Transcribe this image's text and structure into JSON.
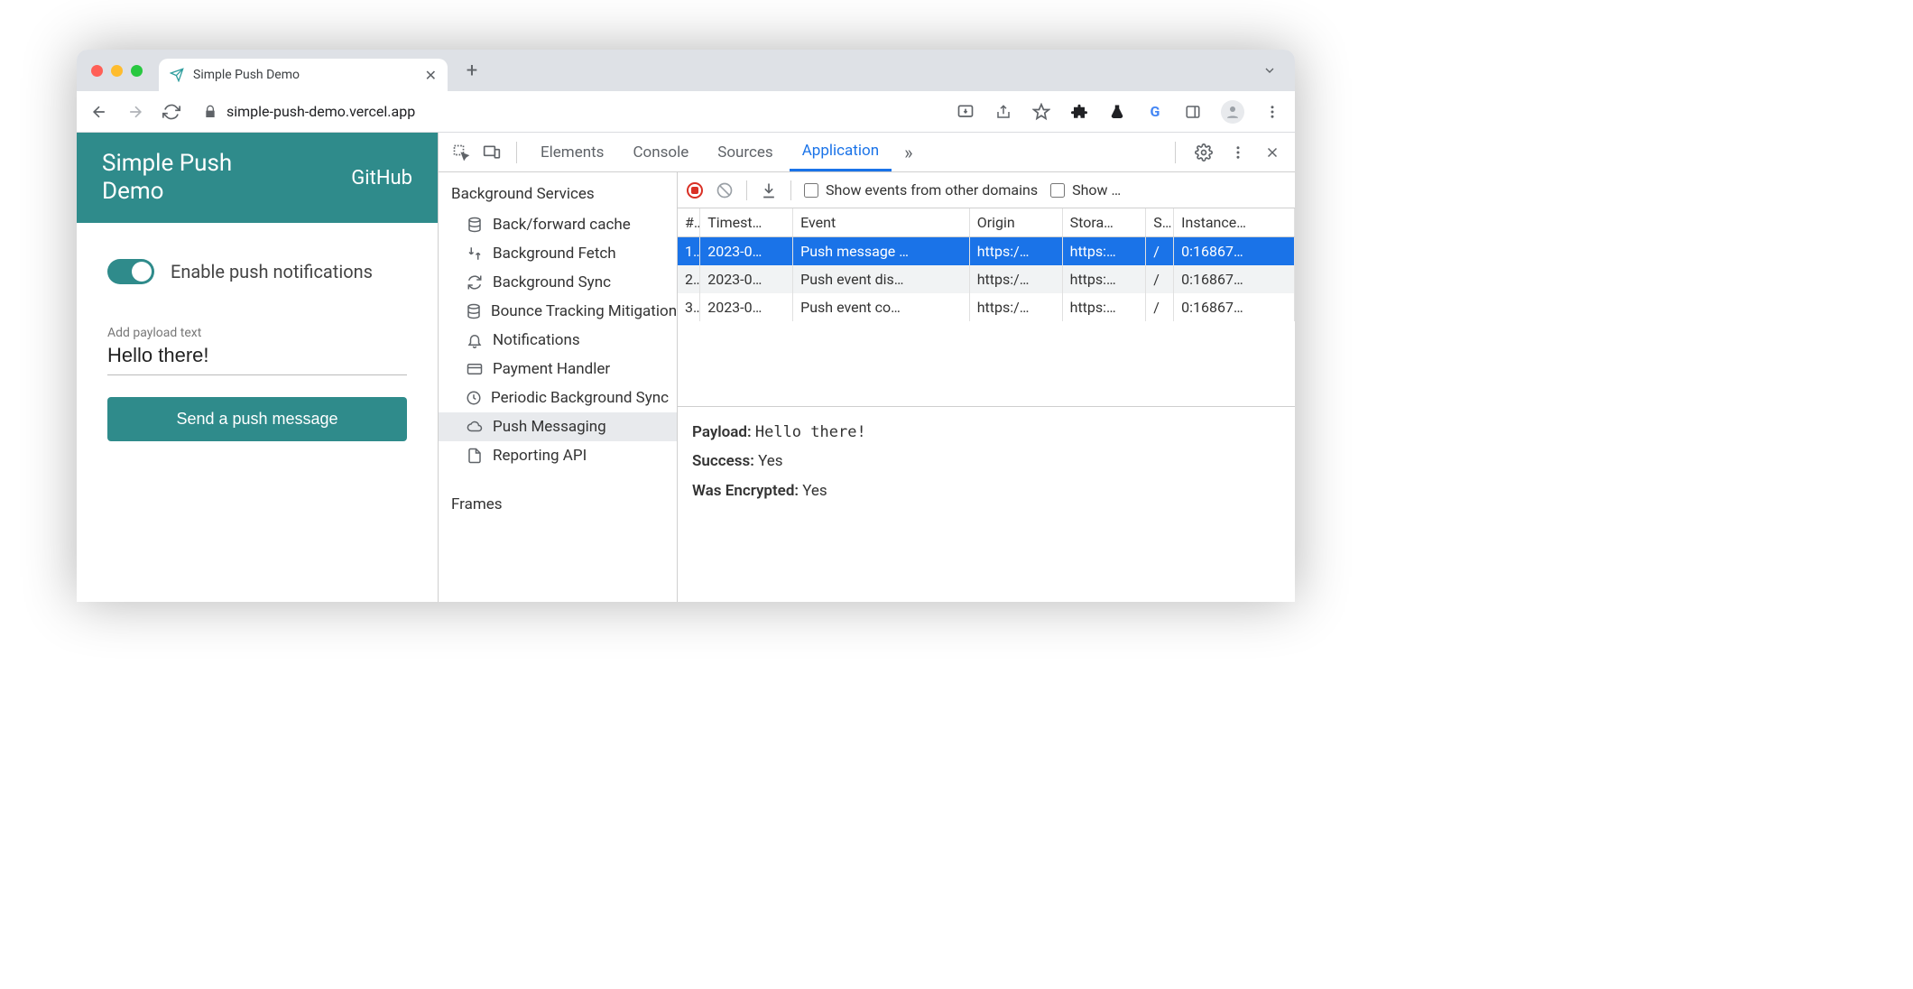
{
  "browser": {
    "tab_title": "Simple Push Demo",
    "new_tab_glyph": "+",
    "url": "simple-push-demo.vercel.app",
    "traffic_colors": {
      "red": "#ff5f57",
      "yellow": "#febc2e",
      "green": "#28c840"
    }
  },
  "page": {
    "title": "Simple Push Demo",
    "github_link": "GitHub",
    "toggle_label": "Enable push notifications",
    "toggle_on": true,
    "payload_label": "Add payload text",
    "payload_value": "Hello there!",
    "send_button": "Send a push message",
    "accent_color": "#2f8b8b"
  },
  "devtools": {
    "tabs": [
      "Elements",
      "Console",
      "Sources",
      "Application"
    ],
    "active_tab": "Application",
    "more_glyph": "»",
    "sidebar": {
      "group1": "Background Services",
      "items": [
        {
          "icon": "database",
          "label": "Back/forward cache"
        },
        {
          "icon": "arrows",
          "label": "Background Fetch"
        },
        {
          "icon": "sync",
          "label": "Background Sync"
        },
        {
          "icon": "database",
          "label": "Bounce Tracking Mitigations"
        },
        {
          "icon": "bell",
          "label": "Notifications"
        },
        {
          "icon": "card",
          "label": "Payment Handler"
        },
        {
          "icon": "clock",
          "label": "Periodic Background Sync"
        },
        {
          "icon": "cloud",
          "label": "Push Messaging",
          "selected": true
        },
        {
          "icon": "file",
          "label": "Reporting API"
        }
      ],
      "group2": "Frames"
    },
    "toolbar": {
      "checkbox1": "Show events from other domains",
      "checkbox2": "Show …"
    },
    "table": {
      "headers": [
        "#",
        "Timest…",
        "Event",
        "Origin",
        "Stora…",
        "S..",
        "Instance…"
      ],
      "rows": [
        {
          "n": "1.",
          "ts": "2023-0…",
          "ev": "Push message …",
          "or": "https:/…",
          "st": "https:…",
          "sp": "/",
          "in": "0:16867…",
          "selected": true
        },
        {
          "n": "2.",
          "ts": "2023-0…",
          "ev": "Push event dis…",
          "or": "https:/…",
          "st": "https:…",
          "sp": "/",
          "in": "0:16867…"
        },
        {
          "n": "3.",
          "ts": "2023-0…",
          "ev": "Push event co…",
          "or": "https:/…",
          "st": "https:…",
          "sp": "/",
          "in": "0:16867…"
        }
      ]
    },
    "detail": {
      "payload_label": "Payload:",
      "payload_value": "Hello there!",
      "success_label": "Success:",
      "success_value": "Yes",
      "encrypted_label": "Was Encrypted:",
      "encrypted_value": "Yes"
    }
  }
}
